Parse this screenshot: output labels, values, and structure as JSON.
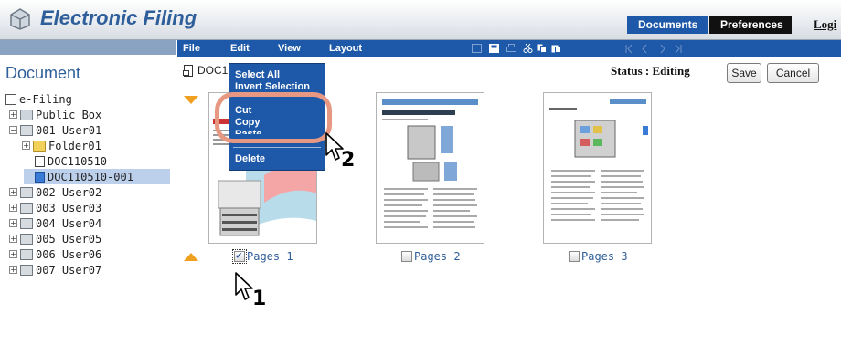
{
  "header": {
    "app_title": "Electronic Filing",
    "documents_label": "Documents",
    "preferences_label": "Preferences",
    "logout_label": "Logi"
  },
  "sidebar": {
    "title": "Document",
    "tree": [
      {
        "label": "e-Filing",
        "icon": "filing-icon"
      },
      {
        "label": "Public Box",
        "icon": "box-icon"
      },
      {
        "label": "001 User01",
        "icon": "user-box-icon"
      },
      {
        "label": "Folder01",
        "icon": "folder-icon"
      },
      {
        "label": "DOC110510",
        "icon": "document-icon"
      },
      {
        "label": "DOC110510-001",
        "icon": "document-icon"
      },
      {
        "label": "002 User02",
        "icon": "user-box-icon"
      },
      {
        "label": "003 User03",
        "icon": "user-box-icon"
      },
      {
        "label": "004 User04",
        "icon": "user-box-icon"
      },
      {
        "label": "005 User05",
        "icon": "user-box-icon"
      },
      {
        "label": "006 User06",
        "icon": "user-box-icon"
      },
      {
        "label": "007 User07",
        "icon": "user-box-icon"
      }
    ]
  },
  "menubar": {
    "file": "File",
    "edit": "Edit",
    "view": "View",
    "layout": "Layout"
  },
  "main": {
    "doc_name": "DOC1",
    "status": "Status : Editing",
    "save_label": "Save",
    "cancel_label": "Cancel",
    "pages": [
      {
        "label": "Pages 1",
        "checked": true
      },
      {
        "label": "Pages 2",
        "checked": false
      },
      {
        "label": "Pages 3",
        "checked": false
      }
    ]
  },
  "edit_menu": {
    "select_all": "Select All",
    "invert_selection": "Invert Selection",
    "cut": "Cut",
    "copy": "Copy",
    "paste": "Paste",
    "delete": "Delete"
  },
  "annotations": {
    "step1": "1",
    "step2": "2"
  },
  "colors": {
    "accent": "#1e58a8",
    "highlight": "#e79882",
    "arrow": "#f0a020"
  }
}
